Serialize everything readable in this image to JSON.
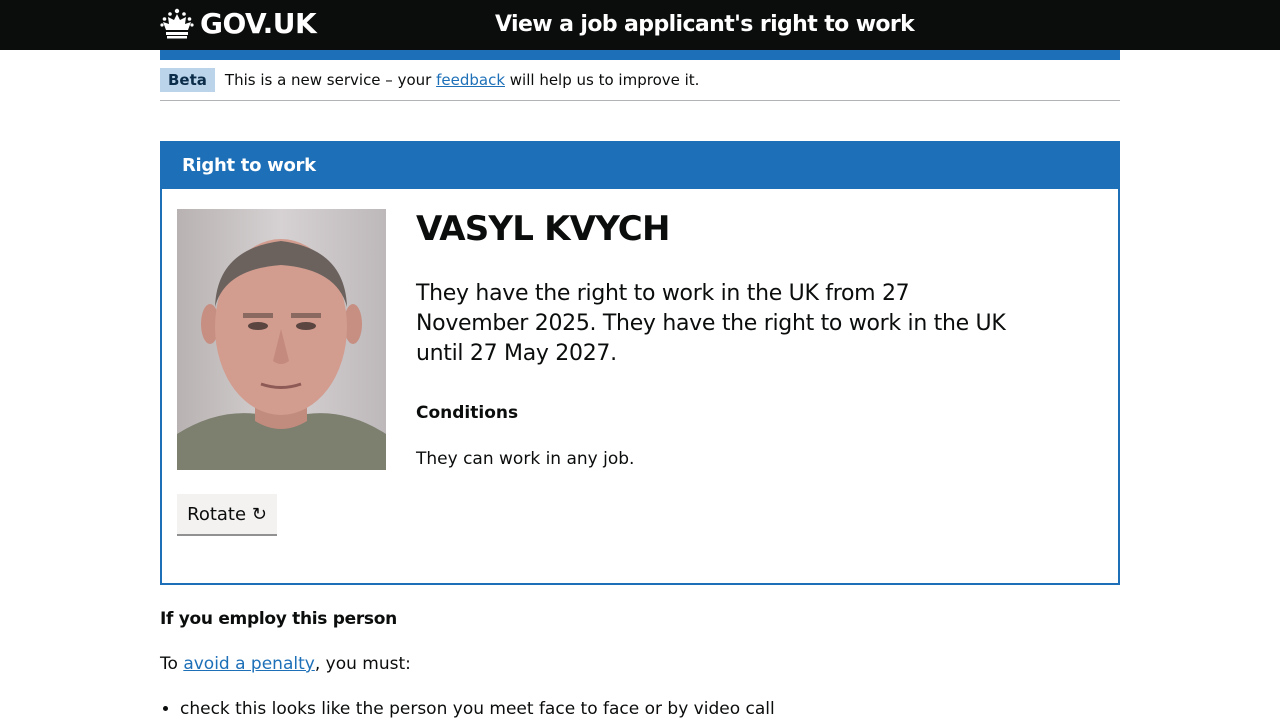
{
  "header": {
    "logo_text": "GOV.UK",
    "service_name": "View a job applicant's right to work"
  },
  "phase_banner": {
    "tag": "Beta",
    "text_before": "This is a new service – your",
    "link_text": "feedback",
    "text_after": "will help us to improve it."
  },
  "card": {
    "heading": "Right to work",
    "person_name": "VASYL KVYCH",
    "summary": "They have the right to work in the UK from 27 November 2025. They have the right to work in the UK until 27 May 2027.",
    "conditions_heading": "Conditions",
    "conditions_text": "They can work in any job.",
    "rotate_label": "Rotate ↻"
  },
  "employ": {
    "heading": "If you employ this person",
    "intro_before": "To",
    "intro_link": "avoid a penalty",
    "intro_after": ", you must:",
    "items": [
      "check this looks like the person you meet face to face or by video call"
    ]
  },
  "colors": {
    "brand_blue": "#1d70b8",
    "header_black": "#0b0c0c",
    "tag_bg": "#bbd4ea"
  },
  "icons": {
    "logo": "crown-icon"
  }
}
